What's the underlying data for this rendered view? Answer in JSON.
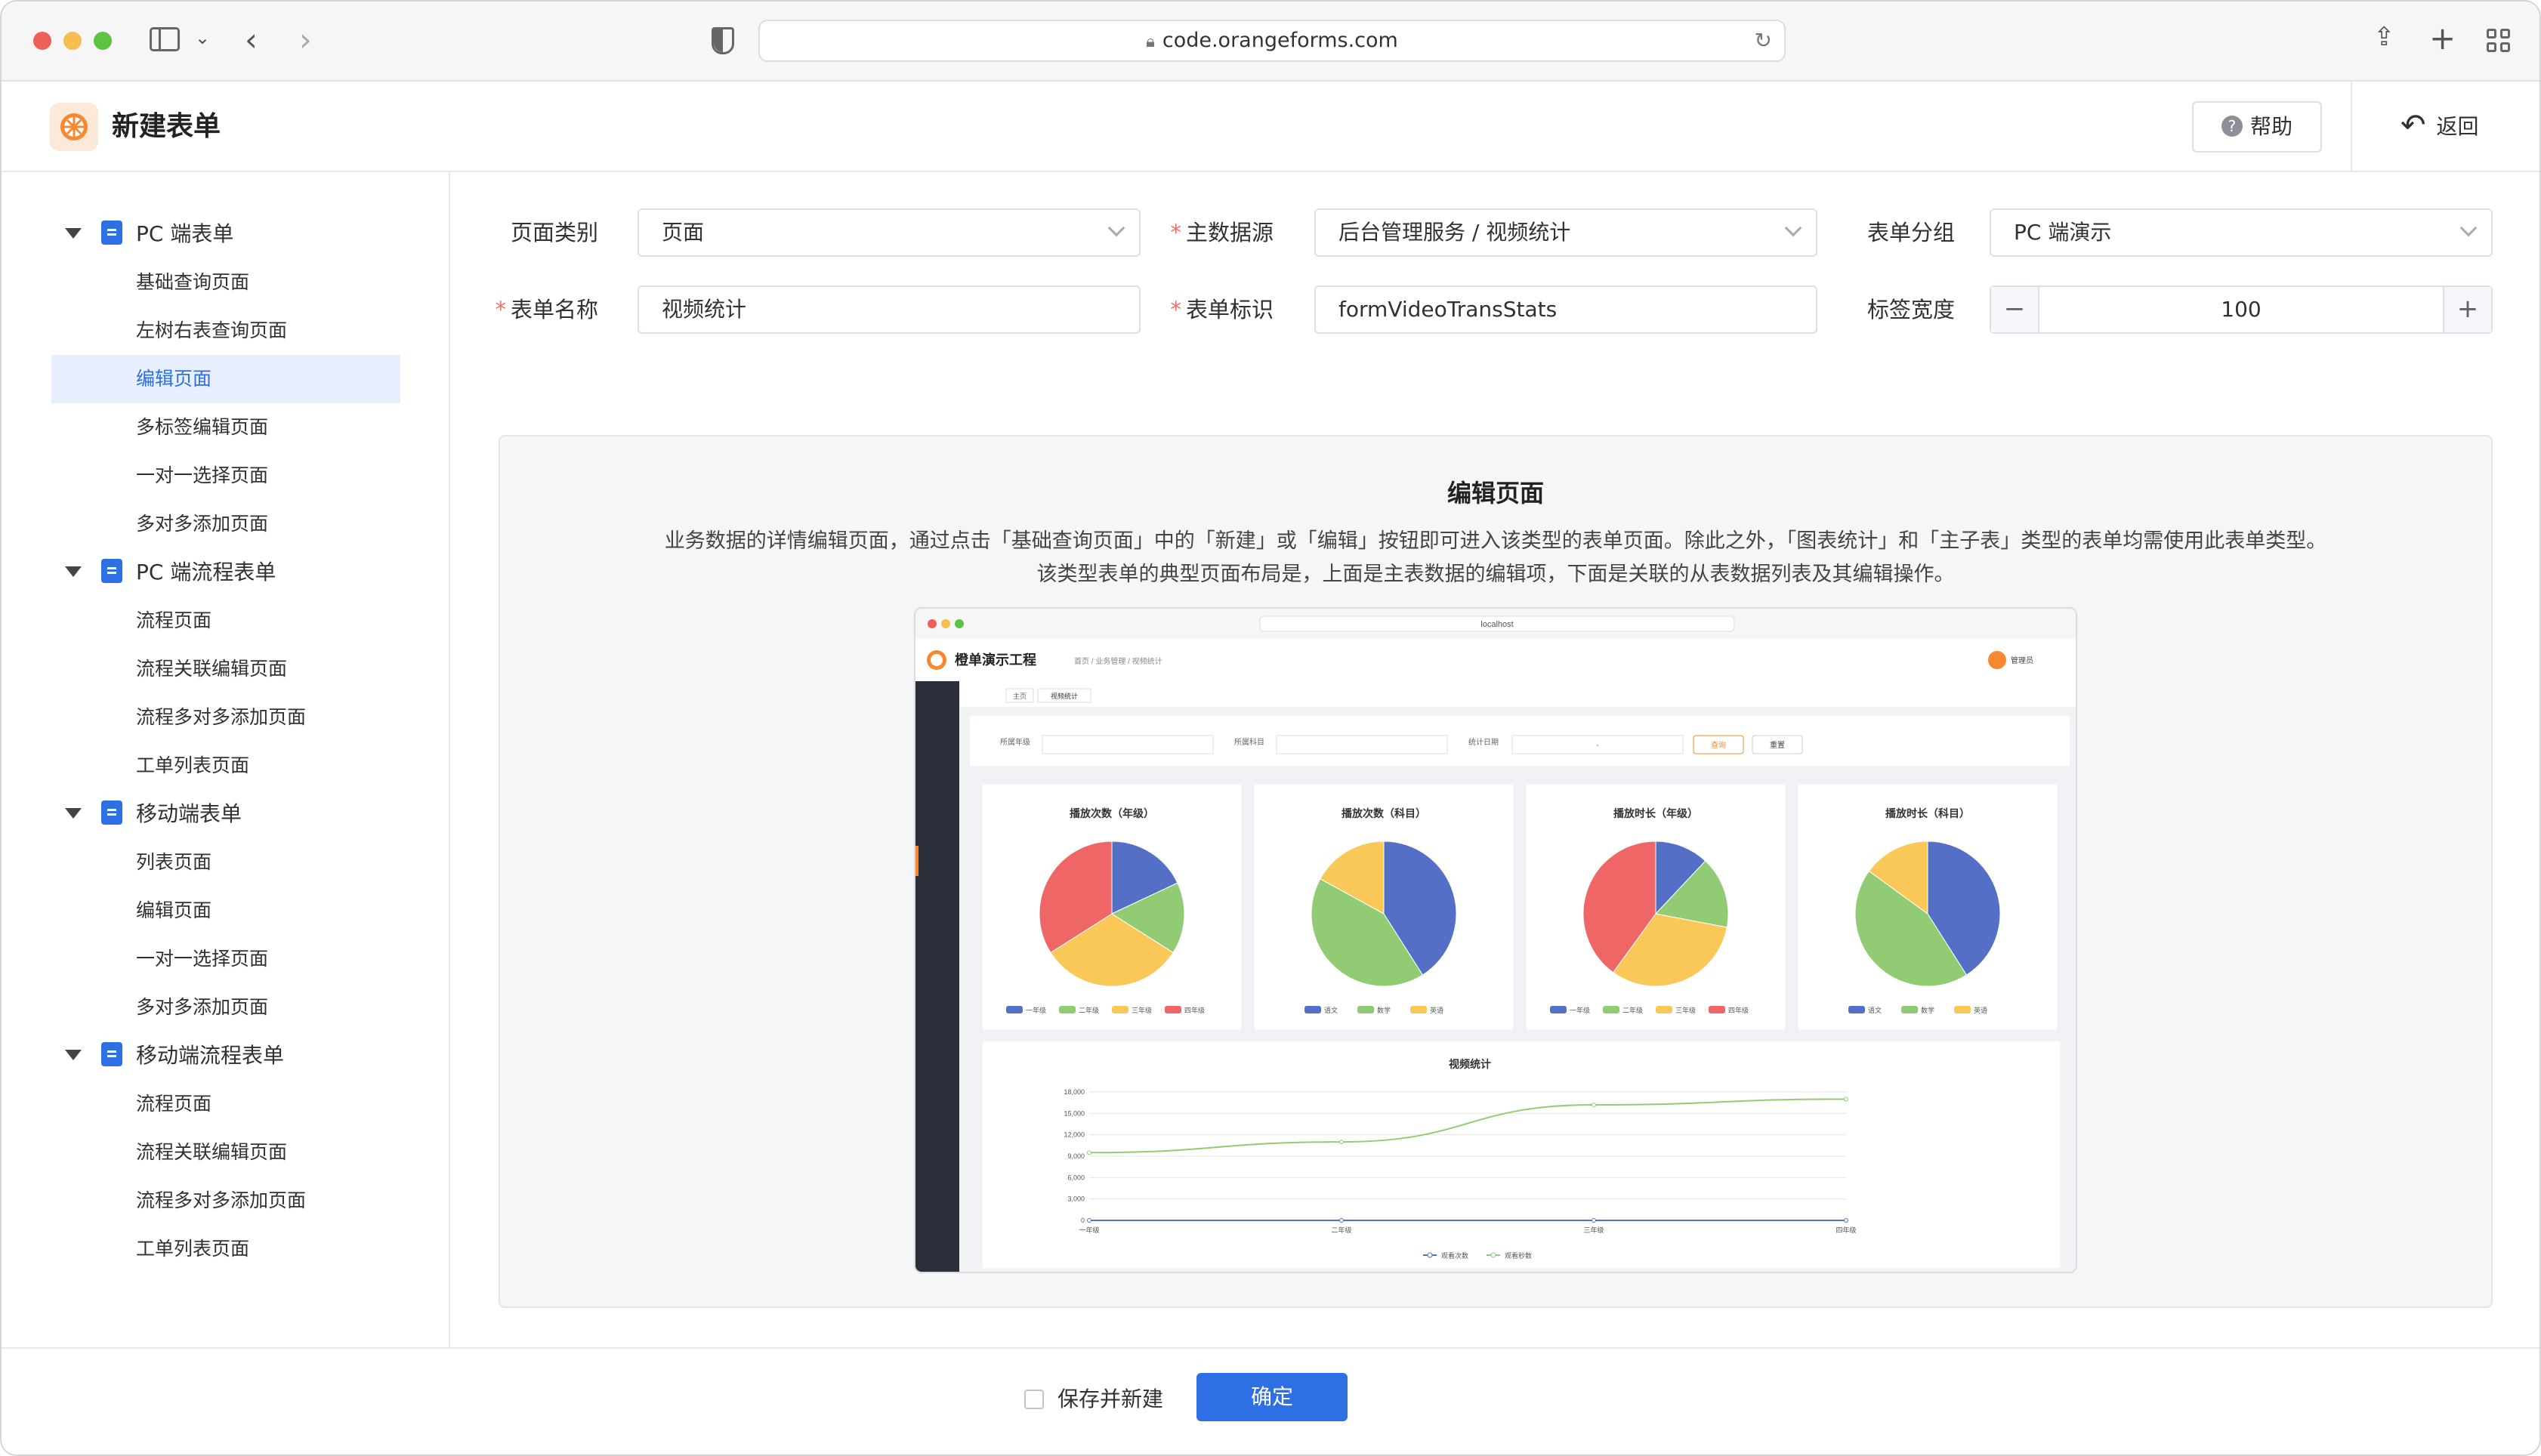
{
  "browser": {
    "url": "code.orangeforms.com"
  },
  "header": {
    "title": "新建表单",
    "help_label": "帮助",
    "back_label": "返回"
  },
  "sidebar": {
    "groups": [
      {
        "label": "PC 端表单",
        "items": [
          "基础查询页面",
          "左树右表查询页面",
          "编辑页面",
          "多标签编辑页面",
          "一对一选择页面",
          "多对多添加页面"
        ]
      },
      {
        "label": "PC 端流程表单",
        "items": [
          "流程页面",
          "流程关联编辑页面",
          "流程多对多添加页面",
          "工单列表页面"
        ]
      },
      {
        "label": "移动端表单",
        "items": [
          "列表页面",
          "编辑页面",
          "一对一选择页面",
          "多对多添加页面"
        ]
      },
      {
        "label": "移动端流程表单",
        "items": [
          "流程页面",
          "流程关联编辑页面",
          "流程多对多添加页面",
          "工单列表页面"
        ]
      }
    ],
    "active_item": "编辑页面"
  },
  "form": {
    "page_type": {
      "label": "页面类别",
      "value": "页面"
    },
    "data_source": {
      "label": "主数据源",
      "value": "后台管理服务 / 视频统计"
    },
    "form_group": {
      "label": "表单分组",
      "value": "PC 端演示"
    },
    "form_name": {
      "label": "表单名称",
      "value": "视频统计"
    },
    "form_id": {
      "label": "表单标识",
      "value": "formVideoTransStats"
    },
    "label_width": {
      "label": "标签宽度",
      "value": "100",
      "minus": "−",
      "plus": "+"
    }
  },
  "preview": {
    "title": "编辑页面",
    "desc_line1": "业务数据的详情编辑页面，通过点击「基础查询页面」中的「新建」或「编辑」按钮即可进入该类型的表单页面。除此之外，「图表统计」和「主子表」类型的表单均需使用此表单类型。",
    "desc_line2": "该类型表单的典型页面布局是，上面是主表数据的编辑项，下面是关联的从表数据列表及其编辑操作。",
    "mock": {
      "url": "localhost",
      "app_title": "橙单演示工程",
      "breadcrumb": "首页 / 业务管理 / 视频统计",
      "admin": "管理员",
      "tabs": [
        "主页",
        "视频统计"
      ],
      "filters": [
        "所属年级",
        "所属科目",
        "统计日期"
      ],
      "query_btn": "查询",
      "reset_btn": "重置",
      "date_sep": "-",
      "pies": [
        {
          "title": "播放次数（年级）",
          "legend": [
            "一年级",
            "二年级",
            "三年级",
            "四年级"
          ],
          "values": [
            18,
            16,
            32,
            34
          ]
        },
        {
          "title": "播放次数（科目）",
          "legend": [
            "语文",
            "数学",
            "英语"
          ],
          "values": [
            41,
            42,
            17
          ]
        },
        {
          "title": "播放时长（年级）",
          "legend": [
            "一年级",
            "二年级",
            "三年级",
            "四年级"
          ],
          "values": [
            12,
            16,
            32,
            40
          ]
        },
        {
          "title": "播放时长（科目）",
          "legend": [
            "语文",
            "数学",
            "英语"
          ],
          "values": [
            41,
            44,
            15
          ]
        }
      ],
      "pie_colors": [
        "#5470c6",
        "#91cc75",
        "#fac858",
        "#ee6666"
      ],
      "line_chart": {
        "title": "视频统计",
        "categories": [
          "一年级",
          "二年级",
          "三年级",
          "四年级"
        ],
        "y_ticks": [
          "18,000",
          "15,000",
          "12,000",
          "9,000",
          "6,000",
          "3,000",
          "0"
        ],
        "ylim": [
          0,
          18000
        ],
        "series": [
          {
            "name": "观看次数",
            "values": [
              0,
              0,
              0,
              0
            ],
            "color": "#5470c6"
          },
          {
            "name": "观看秒数",
            "values": [
              9500,
              11000,
              16200,
              17000
            ],
            "color": "#91cc75"
          }
        ]
      }
    }
  },
  "footer": {
    "save_new_label": "保存并新建",
    "confirm_label": "确定"
  },
  "colors": {
    "primary": "#2f6fe4",
    "required": "#f56c6c"
  }
}
